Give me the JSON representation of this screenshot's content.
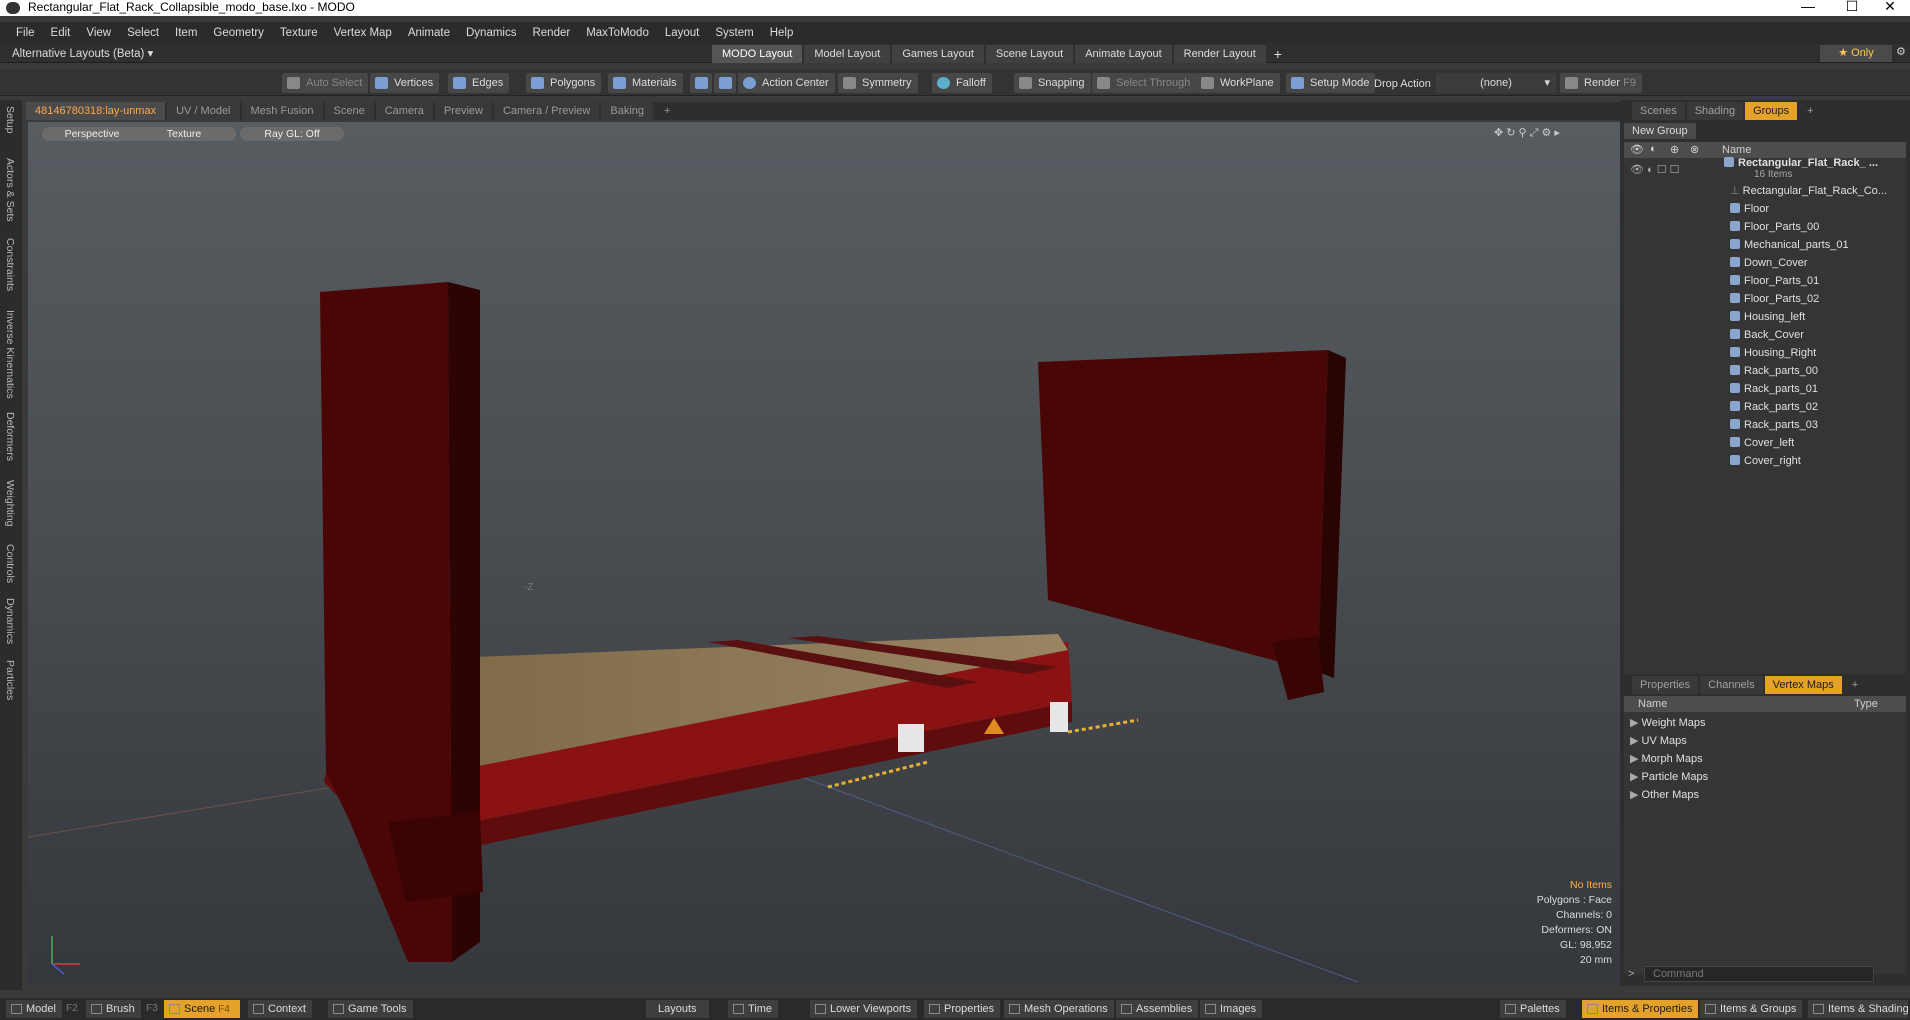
{
  "window": {
    "title": "Rectangular_Flat_Rack_Collapsible_modo_base.lxo - MODO",
    "minimize": "—",
    "maximize": "☐",
    "close": "✕"
  },
  "menu": [
    "File",
    "Edit",
    "View",
    "Select",
    "Item",
    "Geometry",
    "Texture",
    "Vertex Map",
    "Animate",
    "Dynamics",
    "Render",
    "MaxToModo",
    "Layout",
    "System",
    "Help"
  ],
  "layouts": {
    "alt": "Alternative Layouts (Beta)",
    "tabs": [
      "MODO Layout",
      "Model Layout",
      "Games Layout",
      "Scene Layout",
      "Animate Layout",
      "Render Layout"
    ],
    "add": "+",
    "only": "★  Only"
  },
  "toolbar": {
    "auto_select": "Auto Select",
    "vertices": "Vertices",
    "edges": "Edges",
    "polygons": "Polygons",
    "materials": "Materials",
    "action_center": "Action Center",
    "symmetry": "Symmetry",
    "falloff": "Falloff",
    "snapping": "Snapping",
    "select_through": "Select Through",
    "workplane": "WorkPlane",
    "setup_mode": "Setup Mode",
    "drop_action": "Drop Action",
    "drop_value": "(none)",
    "render": "Render",
    "render_key": "F9"
  },
  "left_tabs": [
    "Setup",
    "Actors & Sets",
    "Constraints",
    "Inverse Kinematics",
    "Deformers",
    "Weighting",
    "Controls",
    "Dynamics",
    "Particles"
  ],
  "viewport_tabs": [
    "48146780318:lay-unmax",
    "UV / Model",
    "Mesh Fusion",
    "Scene",
    "Camera",
    "Preview",
    "Camera / Preview",
    "Baking",
    "+"
  ],
  "viewport": {
    "view": "Perspective",
    "shading": "Texture",
    "raygl": "Ray GL: Off",
    "axis_z": "-Z",
    "info": {
      "items": "No Items",
      "polygons": "Polygons : Face",
      "channels": "Channels: 0",
      "deformers": "Deformers: ON",
      "gl": "GL: 98,952",
      "scale": "20 mm"
    }
  },
  "right_tabs": [
    "Scenes",
    "Shading",
    "Groups",
    "+"
  ],
  "groups": {
    "new_group": "New Group",
    "col_name": "Name",
    "root": "Rectangular_Flat_Rack_ ...",
    "count": "16 Items",
    "items": [
      "Rectangular_Flat_Rack_Co...",
      "Floor",
      "Floor_Parts_00",
      "Mechanical_parts_01",
      "Down_Cover",
      "Floor_Parts_01",
      "Floor_Parts_02",
      "Housing_left",
      "Back_Cover",
      "Housing_Right",
      "Rack_parts_00",
      "Rack_parts_01",
      "Rack_parts_02",
      "Rack_parts_03",
      "Cover_left",
      "Cover_right"
    ]
  },
  "lower_tabs": [
    "Properties",
    "Channels",
    "Vertex Maps",
    "+"
  ],
  "vertex_maps": {
    "col_name": "Name",
    "col_type": "Type",
    "items": [
      "Weight Maps",
      "UV Maps",
      "Morph Maps",
      "Particle Maps",
      "Other Maps"
    ]
  },
  "command": {
    "placeholder": "Command"
  },
  "bottom": {
    "model": "Model",
    "model_key": "F2",
    "brush": "Brush",
    "brush_key": "F3",
    "scene": "Scene",
    "scene_key": "F4",
    "context": "Context",
    "game_tools": "Game Tools",
    "layouts": "Layouts",
    "time": "Time",
    "lower_viewports": "Lower Viewports",
    "properties": "Properties",
    "mesh_operations": "Mesh Operations",
    "assemblies": "Assemblies",
    "images": "Images",
    "palettes": "Palettes",
    "items_properties": "Items & Properties",
    "items_groups": "Items & Groups",
    "items_shading": "Items & Shading"
  }
}
